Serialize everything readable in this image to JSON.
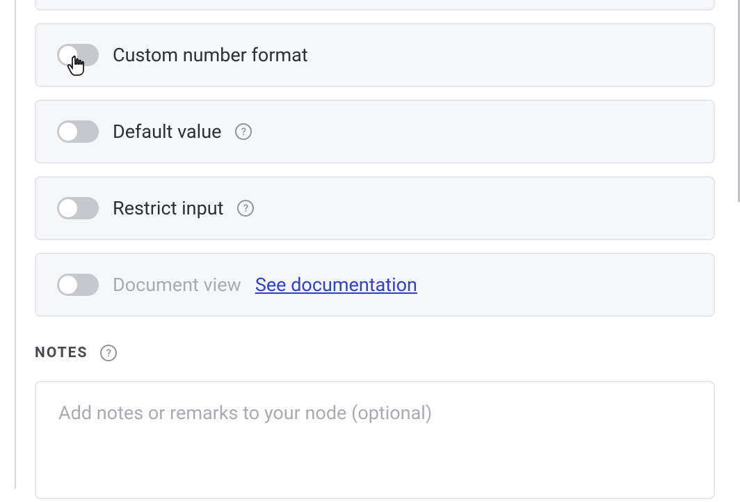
{
  "options": {
    "custom_number_format": {
      "label": "Custom number format",
      "hasHelp": false
    },
    "default_value": {
      "label": "Default value",
      "hasHelp": true
    },
    "restrict_input": {
      "label": "Restrict input",
      "hasHelp": true
    },
    "document_view": {
      "label": "Document view",
      "link_text": "See documentation"
    }
  },
  "notes": {
    "heading": "NOTES",
    "placeholder": "Add notes or remarks to your node (optional)"
  },
  "icons": {
    "help_glyph": "?"
  }
}
